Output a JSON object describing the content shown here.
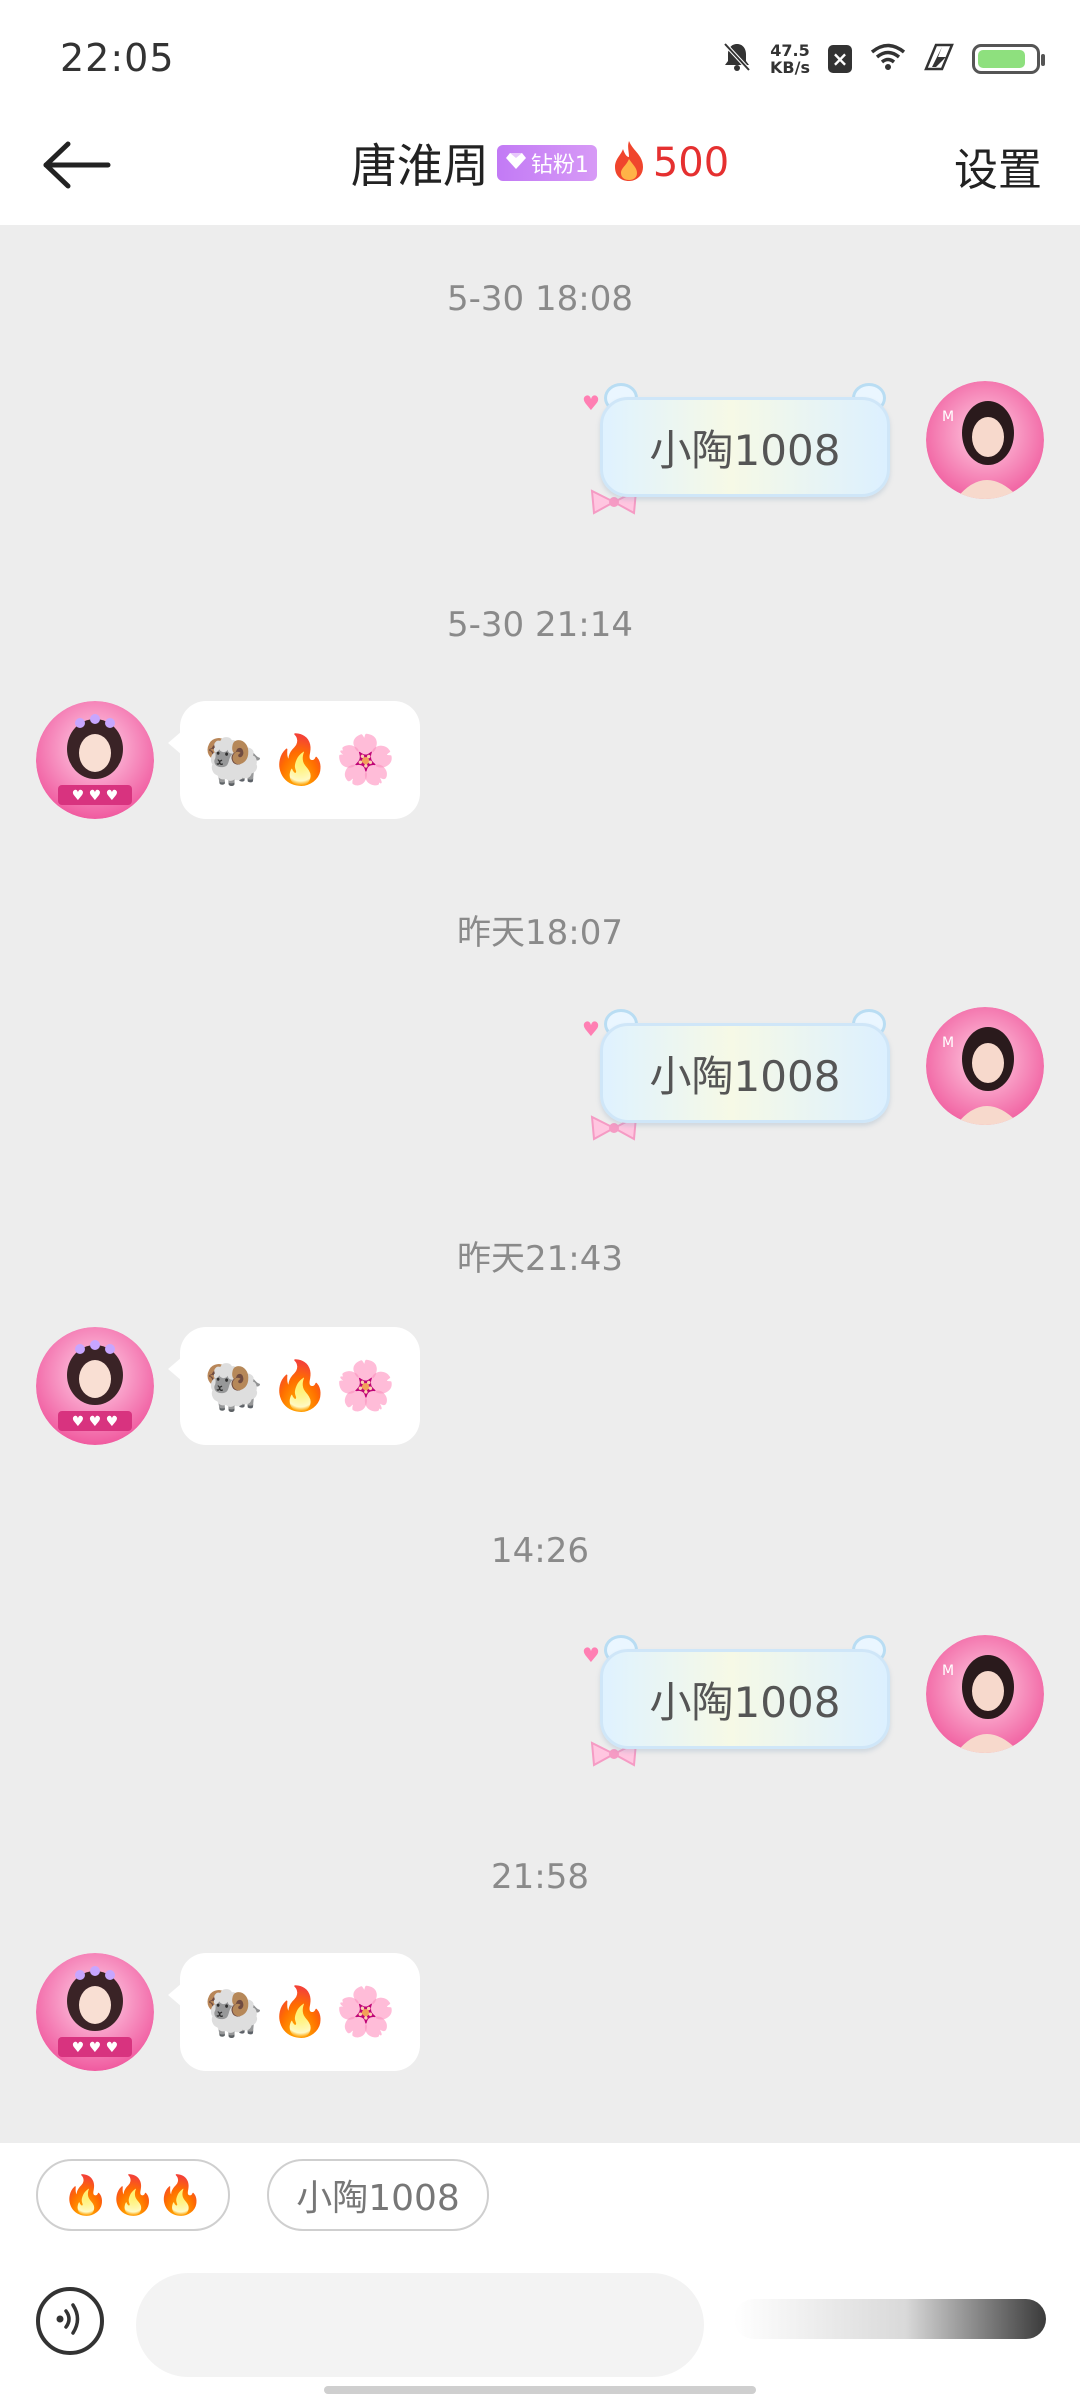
{
  "status_bar": {
    "time": "22:05",
    "net_speed_value": "47.5",
    "net_speed_unit": "KB/s",
    "icons": [
      "mute-bell-icon",
      "data-blocked-icon",
      "wifi-icon",
      "charging-icon",
      "battery-icon"
    ]
  },
  "header": {
    "back_icon": "back-arrow-icon",
    "title": "唐淮周",
    "fan_badge": "钻粉1",
    "flame_count": "500",
    "settings_label": "设置"
  },
  "messages": [
    {
      "time": "5-30 18:08",
      "from": "me",
      "text": "小陶1008"
    },
    {
      "time": "5-30 21:14",
      "from": "other",
      "emojis": [
        "🐏",
        "🔥",
        "🌸"
      ]
    },
    {
      "time": "昨天18:07",
      "from": "me",
      "text": "小陶1008"
    },
    {
      "time": "昨天21:43",
      "from": "other",
      "emojis": [
        "🐏",
        "🔥",
        "🌸"
      ]
    },
    {
      "time": "14:26",
      "from": "me",
      "text": "小陶1008"
    },
    {
      "time": "21:58",
      "from": "other",
      "emojis": [
        "🐏",
        "🔥",
        "🌸"
      ]
    }
  ],
  "quick_replies": [
    "🔥🔥🔥",
    "小陶1008"
  ],
  "input": {
    "placeholder": "",
    "voice_icon": "voice-input-icon"
  },
  "colors": {
    "chat_bg": "#ededed",
    "flame_count": "#e53030",
    "fan_badge": "#c27af5",
    "avatar_pink": "#f35ba0"
  }
}
